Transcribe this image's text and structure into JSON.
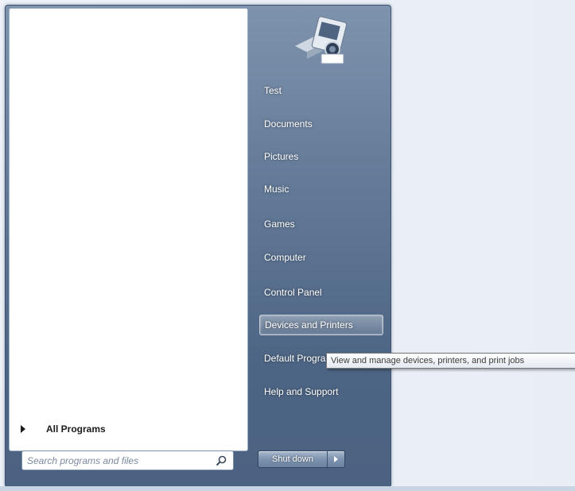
{
  "start_menu": {
    "all_programs_label": "All Programs",
    "search": {
      "placeholder": "Search programs and files",
      "icon": "search-icon"
    },
    "user_picture_icon": "camera-icon",
    "right_items": [
      {
        "label": "Test",
        "name": "right-item-test"
      },
      {
        "label": "Documents",
        "name": "right-item-documents"
      },
      {
        "label": "Pictures",
        "name": "right-item-pictures"
      },
      {
        "label": "Music",
        "name": "right-item-music"
      },
      {
        "label": "Games",
        "name": "right-item-games"
      },
      {
        "label": "Computer",
        "name": "right-item-computer"
      },
      {
        "label": "Control Panel",
        "name": "right-item-control-panel"
      },
      {
        "label": "Devices and Printers",
        "name": "right-item-devices-and-printers",
        "highlighted": true
      },
      {
        "label": "Default Programs",
        "name": "right-item-default-programs"
      },
      {
        "label": "Help and Support",
        "name": "right-item-help-and-support"
      }
    ],
    "shutdown": {
      "label": "Shut down",
      "arrow_icon": "chevron-right-icon"
    }
  },
  "tooltip": {
    "text": "View and manage devices, printers, and print jobs"
  },
  "colors": {
    "menu_frame": "#617896",
    "left_pane": "#ffffff",
    "highlight": "#ffffff",
    "desktop": "#eef2f8"
  }
}
